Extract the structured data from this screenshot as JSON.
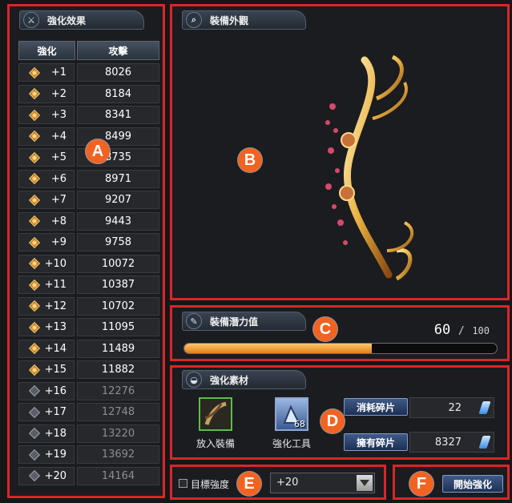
{
  "enhance_effects": {
    "title": "強化效果",
    "icon": "sword-icon",
    "col_level": "強化",
    "col_attack": "攻擊",
    "rows": [
      {
        "level": "+1",
        "attack": "8026",
        "unlocked": true
      },
      {
        "level": "+2",
        "attack": "8184",
        "unlocked": true
      },
      {
        "level": "+3",
        "attack": "8341",
        "unlocked": true
      },
      {
        "level": "+4",
        "attack": "8499",
        "unlocked": true
      },
      {
        "level": "+5",
        "attack": "8735",
        "unlocked": true
      },
      {
        "level": "+6",
        "attack": "8971",
        "unlocked": true
      },
      {
        "level": "+7",
        "attack": "9207",
        "unlocked": true
      },
      {
        "level": "+8",
        "attack": "9443",
        "unlocked": true
      },
      {
        "level": "+9",
        "attack": "9758",
        "unlocked": true
      },
      {
        "level": "+10",
        "attack": "10072",
        "unlocked": true
      },
      {
        "level": "+11",
        "attack": "10387",
        "unlocked": true
      },
      {
        "level": "+12",
        "attack": "10702",
        "unlocked": true
      },
      {
        "level": "+13",
        "attack": "11095",
        "unlocked": true
      },
      {
        "level": "+14",
        "attack": "11489",
        "unlocked": true
      },
      {
        "level": "+15",
        "attack": "11882",
        "unlocked": true
      },
      {
        "level": "+16",
        "attack": "12276",
        "unlocked": false
      },
      {
        "level": "+17",
        "attack": "12748",
        "unlocked": false
      },
      {
        "level": "+18",
        "attack": "13220",
        "unlocked": false
      },
      {
        "level": "+19",
        "attack": "13692",
        "unlocked": false
      },
      {
        "level": "+20",
        "attack": "14164",
        "unlocked": false
      }
    ]
  },
  "appearance": {
    "title": "裝備外觀",
    "icon": "magnifier-icon"
  },
  "potential": {
    "title": "裝備潛力值",
    "icon": "book-icon",
    "current": "60",
    "separator": "/",
    "max": "100",
    "fraction": 0.6
  },
  "materials": {
    "title": "強化素材",
    "icon": "pouch-icon",
    "slot_equipment_label": "放入裝備",
    "slot_tool_label": "強化工具",
    "tool_count": "68",
    "consume_label": "消耗碎片",
    "consume_value": "22",
    "owned_label": "擁有碎片",
    "owned_value": "8327"
  },
  "target": {
    "checkbox_label": "目標強度",
    "selected": "+20"
  },
  "start_button": "開始強化",
  "badges": {
    "a": "A",
    "b": "B",
    "c": "C",
    "d": "D",
    "e": "E",
    "f": "F"
  },
  "colors": {
    "annotation_red": "#d8262a",
    "badge_orange": "#f26322",
    "bar_orange": "#f39a2b"
  }
}
